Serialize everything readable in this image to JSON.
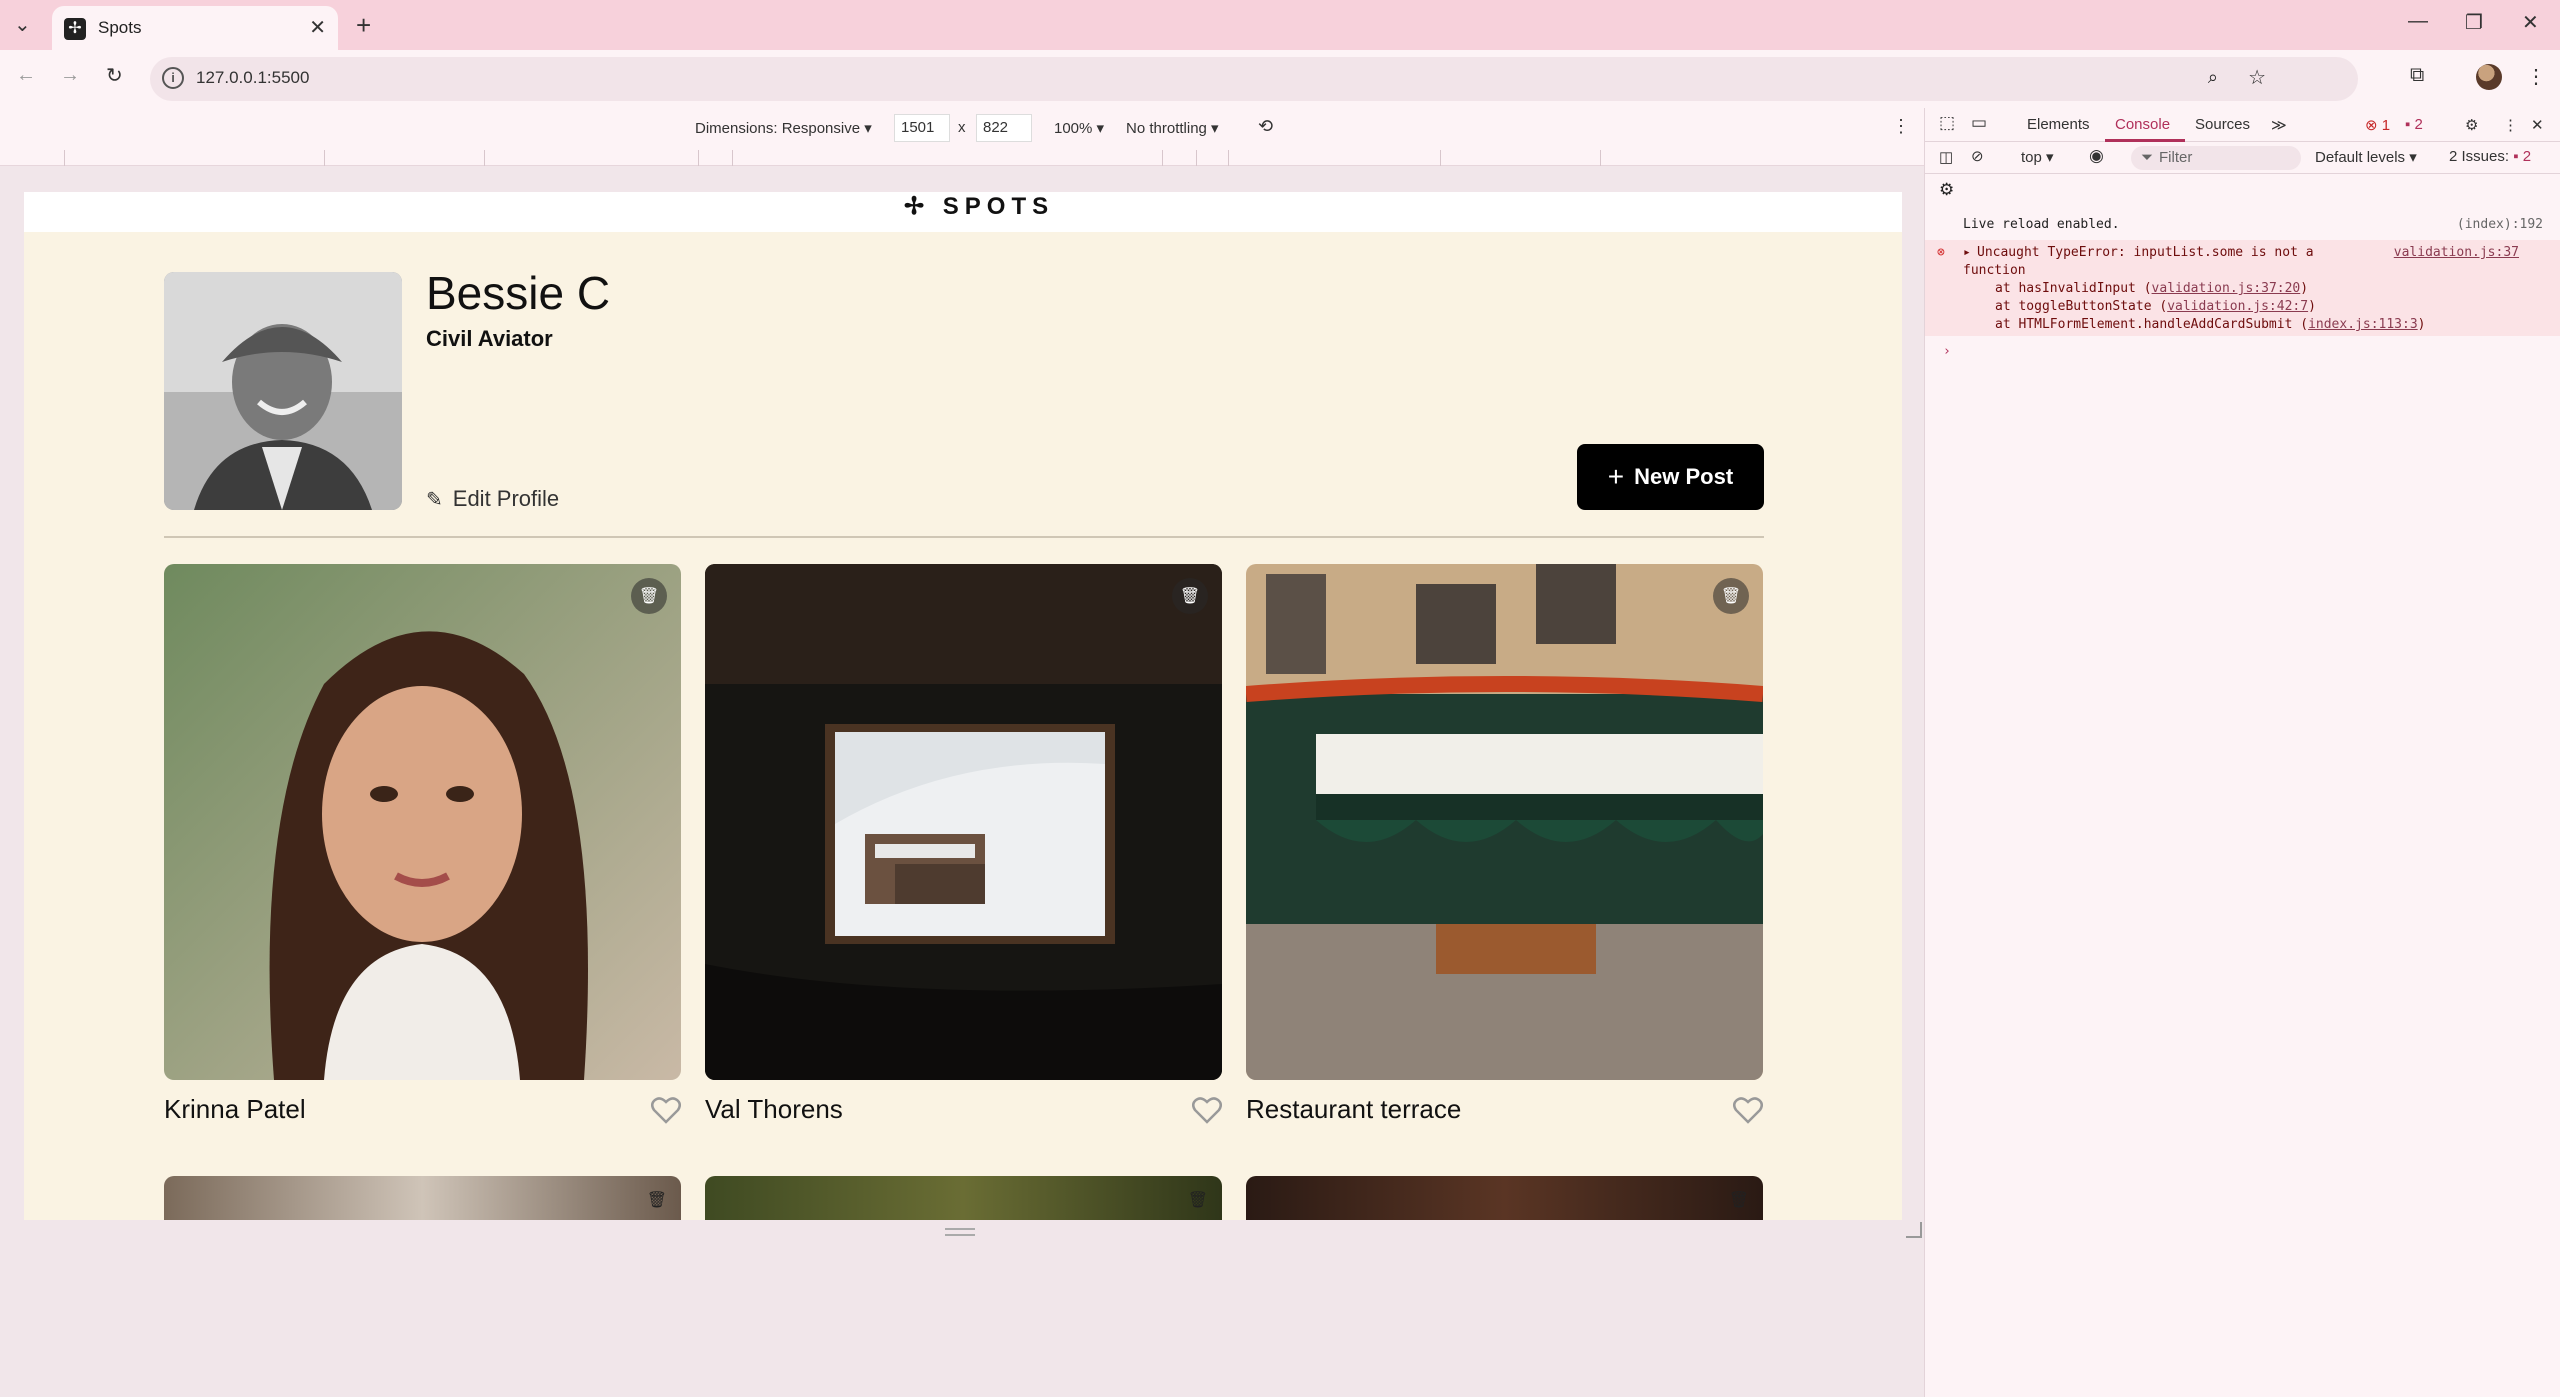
{
  "browser": {
    "tab_title": "Spots",
    "url": "127.0.0.1:5500"
  },
  "device_toolbar": {
    "dimensions_label": "Dimensions: Responsive",
    "width": "1501",
    "times": "x",
    "height": "822",
    "zoom": "100%",
    "throttling": "No throttling"
  },
  "page": {
    "logo": "SPOTS",
    "profile": {
      "name": "Bessie C",
      "title": "Civil Aviator",
      "edit_label": "Edit Profile",
      "new_post_label": "New Post"
    },
    "cards": [
      {
        "caption": "Krinna Patel"
      },
      {
        "caption": "Val Thorens"
      },
      {
        "caption": "Restaurant terrace"
      }
    ]
  },
  "devtools": {
    "tabs": [
      "Elements",
      "Console",
      "Sources"
    ],
    "error_count": "1",
    "issue_badge_count": "2",
    "context": "top",
    "filter_placeholder": "Filter",
    "levels": "Default levels",
    "issues_label": "2 Issues:",
    "issues_count": "2",
    "console": {
      "live_reload": "Live reload enabled.",
      "live_reload_src": "(index):192",
      "error_head": "Uncaught TypeError: inputList.some is not a",
      "error_head2": "function",
      "error_src": "validation.js:37",
      "stack": [
        {
          "prefix": "at hasInvalidInput (",
          "link": "validation.js:37:20",
          "suffix": ")"
        },
        {
          "prefix": "at toggleButtonState (",
          "link": "validation.js:42:7",
          "suffix": ")"
        },
        {
          "prefix": "at HTMLFormElement.handleAddCardSubmit (",
          "link": "index.js:113:3",
          "suffix": ")"
        }
      ]
    }
  },
  "colors": {
    "tabstrip": "#f7d1db",
    "page_bg": "#faf3e3",
    "accent": "#b0305a"
  }
}
